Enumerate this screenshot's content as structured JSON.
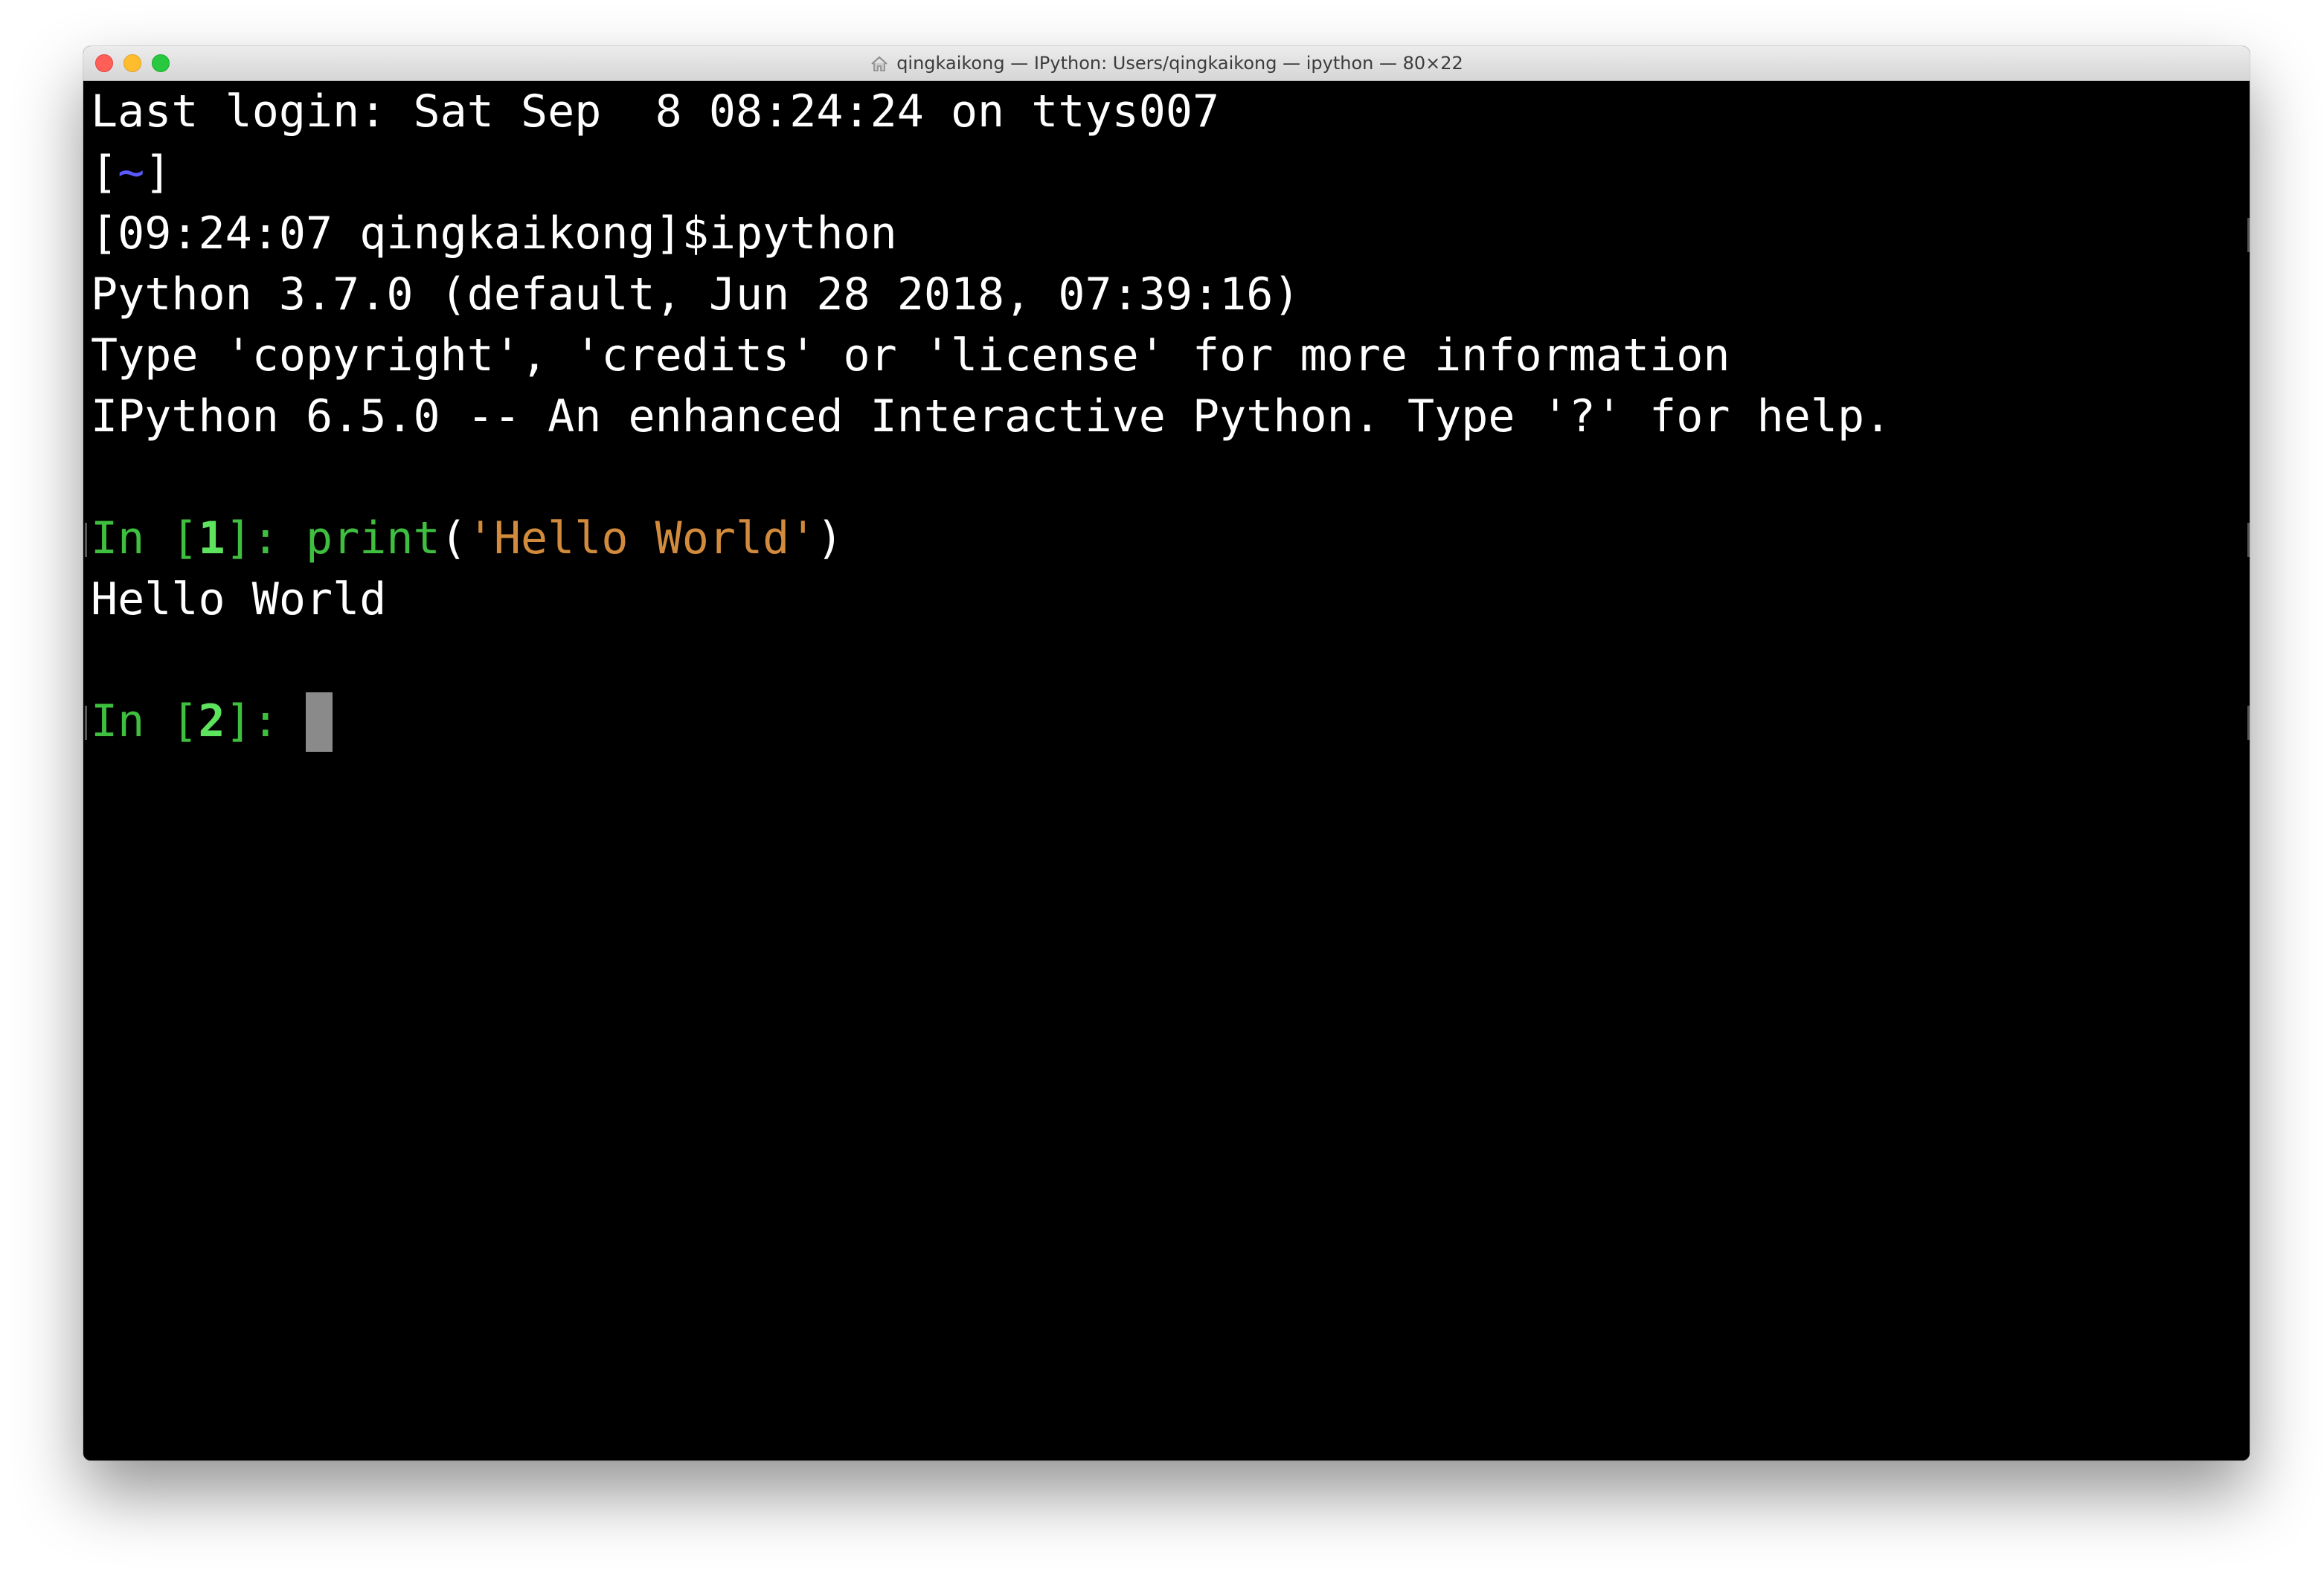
{
  "window": {
    "title": "qingkaikong — IPython: Users/qingkaikong — ipython — 80×22"
  },
  "terminal": {
    "lines": {
      "l0": "Last login: Sat Sep  8 08:24:24 on ttys007",
      "l1_open": "[",
      "l1_tilde": "~",
      "l1_close": "]",
      "l2": "[09:24:07 qingkaikong]$ipython",
      "l3": "Python 3.7.0 (default, Jun 28 2018, 07:39:16)",
      "l4": "Type 'copyright', 'credits' or 'license' for more information",
      "l5": "IPython 6.5.0 -- An enhanced Interactive Python. Type '?' for help.",
      "in1_pre": "In [",
      "in1_num": "1",
      "in1_post": "]: ",
      "in1_func": "print",
      "in1_paren_open": "(",
      "in1_str": "'Hello World'",
      "in1_paren_close": ")",
      "out1": "Hello World",
      "in2_pre": "In [",
      "in2_num": "2",
      "in2_post": "]: "
    }
  },
  "colors": {
    "background": "#000000",
    "text": "#ffffff",
    "prompt": "#3fbf3f",
    "prompt_number": "#5ee35e",
    "string": "#d28b3c",
    "tilde": "#5a5aff",
    "cursor": "#8a8a8a"
  },
  "icons": {
    "title": "home-icon",
    "window_controls": [
      "close-button",
      "minimize-button",
      "zoom-button"
    ]
  }
}
